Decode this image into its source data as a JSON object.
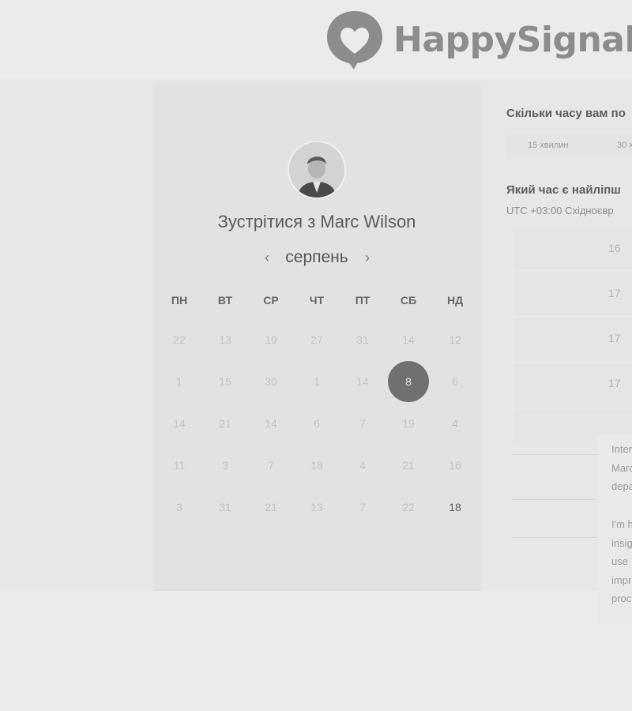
{
  "header": {
    "brand": "HappySignals",
    "logo_icon": "heart-speech-bubble-icon"
  },
  "calendar": {
    "title": "Зустрітися з Marc Wilson",
    "month": "серпень",
    "prev_icon": "‹",
    "next_icon": "›",
    "weekdays": [
      "ПН",
      "ВТ",
      "СР",
      "ЧТ",
      "ПТ",
      "СБ",
      "НД"
    ],
    "weeks": [
      [
        "22",
        "13",
        "19",
        "27",
        "31",
        "14",
        "12"
      ],
      [
        "1",
        "15",
        "30",
        "1",
        "14",
        "8",
        "6"
      ],
      [
        "14",
        "21",
        "14",
        "6",
        "7",
        "19",
        "4"
      ],
      [
        "11",
        "3",
        "7",
        "18",
        "4",
        "21",
        "16"
      ],
      [
        "3",
        "31",
        "21",
        "13",
        "7",
        "22",
        "18"
      ]
    ],
    "selected_day": "8",
    "highlighted_day": "18"
  },
  "booking": {
    "duration_question": "Скільки часу вам по",
    "durations": [
      "15 хвилин",
      "30 х"
    ],
    "time_question": "Який час є найліпш",
    "timezone": "UTC +03:00 Східноєвр",
    "slots": [
      "16",
      "17",
      "17",
      "17"
    ]
  },
  "profile": {
    "bio_lines": [
      "Inter",
      "Marc",
      "depa",
      "I'm h",
      "insig",
      "use",
      "impr",
      "proc"
    ]
  },
  "colors": {
    "selected_day_bg": "#707070",
    "brand": "#8c8c8c",
    "background": "#ebebeb"
  }
}
